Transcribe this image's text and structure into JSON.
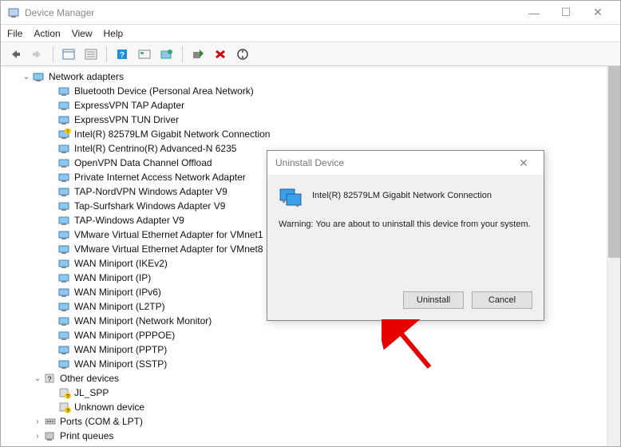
{
  "window": {
    "title": "Device Manager",
    "controls": {
      "min": "—",
      "max": "☐",
      "close": "✕"
    }
  },
  "menu": {
    "items": [
      "File",
      "Action",
      "View",
      "Help"
    ]
  },
  "tree": {
    "root": {
      "label": "Network adapters",
      "expanded": true,
      "children": [
        {
          "label": "Bluetooth Device (Personal Area Network)",
          "warn": false
        },
        {
          "label": "ExpressVPN TAP Adapter",
          "warn": false
        },
        {
          "label": "ExpressVPN TUN Driver",
          "warn": false
        },
        {
          "label": "Intel(R) 82579LM Gigabit Network Connection",
          "warn": true
        },
        {
          "label": "Intel(R) Centrino(R) Advanced-N 6235",
          "warn": false
        },
        {
          "label": "OpenVPN Data Channel Offload",
          "warn": false
        },
        {
          "label": "Private Internet Access Network Adapter",
          "warn": false
        },
        {
          "label": "TAP-NordVPN Windows Adapter V9",
          "warn": false
        },
        {
          "label": "Tap-Surfshark Windows Adapter V9",
          "warn": false
        },
        {
          "label": "TAP-Windows Adapter V9",
          "warn": false
        },
        {
          "label": "VMware Virtual Ethernet Adapter for VMnet1",
          "warn": false
        },
        {
          "label": "VMware Virtual Ethernet Adapter for VMnet8",
          "warn": false
        },
        {
          "label": "WAN Miniport (IKEv2)",
          "warn": false
        },
        {
          "label": "WAN Miniport (IP)",
          "warn": false
        },
        {
          "label": "WAN Miniport (IPv6)",
          "warn": false
        },
        {
          "label": "WAN Miniport (L2TP)",
          "warn": false
        },
        {
          "label": "WAN Miniport (Network Monitor)",
          "warn": false
        },
        {
          "label": "WAN Miniport (PPPOE)",
          "warn": false
        },
        {
          "label": "WAN Miniport (PPTP)",
          "warn": false
        },
        {
          "label": "WAN Miniport (SSTP)",
          "warn": false
        }
      ]
    },
    "other": {
      "label": "Other devices",
      "expanded": true,
      "children": [
        {
          "label": "JL_SPP"
        },
        {
          "label": "Unknown device"
        }
      ]
    },
    "collapsed": [
      {
        "label": "Ports (COM & LPT)"
      },
      {
        "label": "Print queues"
      }
    ]
  },
  "dialog": {
    "title": "Uninstall Device",
    "device": "Intel(R) 82579LM Gigabit Network Connection",
    "warning": "Warning: You are about to uninstall this device from your system.",
    "buttons": {
      "ok": "Uninstall",
      "cancel": "Cancel"
    }
  }
}
